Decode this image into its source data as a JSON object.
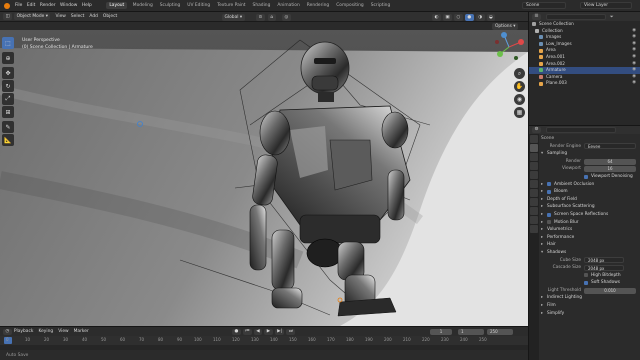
{
  "topbar": {
    "menus": [
      "File",
      "Edit",
      "Render",
      "Window",
      "Help"
    ],
    "workspaces": [
      "Layout",
      "Modeling",
      "Sculpting",
      "UV Editing",
      "Texture Paint",
      "Shading",
      "Animation",
      "Rendering",
      "Compositing",
      "Scripting"
    ],
    "active_workspace": "Layout",
    "scene": "Scene",
    "view_layer": "View Layer"
  },
  "viewport_header": {
    "mode": "Object Mode",
    "menus": [
      "View",
      "Select",
      "Add",
      "Object"
    ],
    "transform": "Global",
    "options": "Options"
  },
  "viewport_info": {
    "line1": "User Perspective",
    "line2": "(0) Scene Collection | Armature"
  },
  "outliner": {
    "title": "Scene Collection",
    "rows": [
      {
        "label": "Collection",
        "color": "#b0b0b0",
        "selected": false
      },
      {
        "label": "Images",
        "color": "#6b8fb3",
        "selected": false
      },
      {
        "label": "Low_Images",
        "color": "#6b8fb3",
        "selected": false
      },
      {
        "label": "Area",
        "color": "#e6a54a",
        "selected": false
      },
      {
        "label": "Area.001",
        "color": "#e6a54a",
        "selected": false
      },
      {
        "label": "Area.002",
        "color": "#e6a54a",
        "selected": false
      },
      {
        "label": "Armature",
        "color": "#59b36b",
        "selected": true
      },
      {
        "label": "Camera",
        "color": "#c97a6a",
        "selected": false
      },
      {
        "label": "Plane.003",
        "color": "#e6a54a",
        "selected": false
      }
    ]
  },
  "properties": {
    "scene_label": "Scene",
    "render_engine_label": "Render Engine",
    "render_engine": "Eevee",
    "sampling": "Sampling",
    "render_label": "Render",
    "render_value": "64",
    "viewport_label": "Viewport",
    "viewport_value": "16",
    "viewport_denoising": "Viewport Denoising",
    "sections": [
      {
        "label": "Ambient Occlusion",
        "checked": true
      },
      {
        "label": "Bloom",
        "checked": true
      },
      {
        "label": "Depth of Field",
        "checked": false
      },
      {
        "label": "Subsurface Scattering",
        "checked": false
      },
      {
        "label": "Screen Space Reflections",
        "checked": true
      },
      {
        "label": "Motion Blur",
        "checked": false
      },
      {
        "label": "Volumetrics",
        "checked": false
      },
      {
        "label": "Performance",
        "checked": false
      },
      {
        "label": "Hair",
        "checked": false
      }
    ],
    "shadows": "Shadows",
    "cube_size_label": "Cube Size",
    "cube_size": "2048 px",
    "cascade_size_label": "Cascade Size",
    "cascade_size": "2048 px",
    "high_bitdepth": "High Bitdepth",
    "soft_shadows": "Soft Shadows",
    "light_threshold_label": "Light Threshold",
    "light_threshold": "0.010",
    "indirect_lighting": "Indirect Lighting",
    "film": "Film",
    "simplify": "Simplify"
  },
  "timeline": {
    "menus": [
      "Playback",
      "Keying",
      "View",
      "Marker"
    ],
    "current_frame": "1",
    "start": "1",
    "end": "250",
    "ticks": [
      "0",
      "10",
      "20",
      "30",
      "40",
      "50",
      "60",
      "70",
      "80",
      "90",
      "100",
      "110",
      "120",
      "130",
      "140",
      "150",
      "160",
      "170",
      "180",
      "190",
      "200",
      "210",
      "220",
      "230",
      "240",
      "250"
    ]
  },
  "statusbar": {
    "left": "Auto Save"
  },
  "colors": {
    "accent": "#4772b3",
    "logo": "#e87d0d",
    "selection": "#334d80"
  }
}
